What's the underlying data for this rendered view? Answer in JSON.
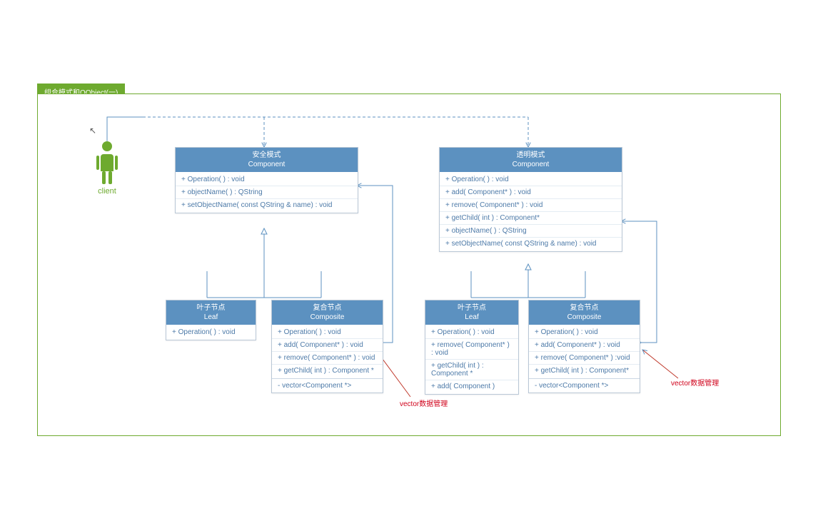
{
  "tab_title": "组合模式和QObject(一)",
  "client_label": "client",
  "classes": {
    "safe_component": {
      "title": "安全模式",
      "subtitle": "Component",
      "ops": [
        "+ Operation( ) : void",
        "+ objectName( ) : QString",
        "+ setObjectName( const QString & name) : void"
      ]
    },
    "transparent_component": {
      "title": "透明模式",
      "subtitle": "Component",
      "ops": [
        "+ Operation( ) : void",
        "+ add( Component* ) : void",
        "+ remove( Component* ) : void",
        "+ getChild( int ) : Component*",
        "+ objectName( ) : QString",
        "+ setObjectName( const QString & name) : void"
      ]
    },
    "leaf_left": {
      "title": "叶子节点",
      "subtitle": "Leaf",
      "ops": [
        "+ Operation( ) : void"
      ]
    },
    "composite_left": {
      "title": "复合节点",
      "subtitle": "Composite",
      "ops": [
        "+ Operation( ) : void",
        "+ add( Component* ) : void",
        "+ remove( Component* ) : void",
        "+ getChild( int ) : Component *"
      ],
      "vec": "- vector<Component *>"
    },
    "leaf_right": {
      "title": "叶子节点",
      "subtitle": "Leaf",
      "ops": [
        "+ Operation( ) : void",
        "+ remove( Component* ) : void",
        "+ getChild( int ) : Component *",
        "+ add( Component )"
      ]
    },
    "composite_right": {
      "title": "复合节点",
      "subtitle": "Composite",
      "ops": [
        "+ Operation( ) : void",
        "+ add( Component* ) : void",
        "+ remove( Component* ) :void",
        "+ getChild( int ) : Component*"
      ],
      "vec": "- vector<Component *>"
    }
  },
  "notes": {
    "left": "vector数据管理",
    "right": "vector数据管理"
  }
}
